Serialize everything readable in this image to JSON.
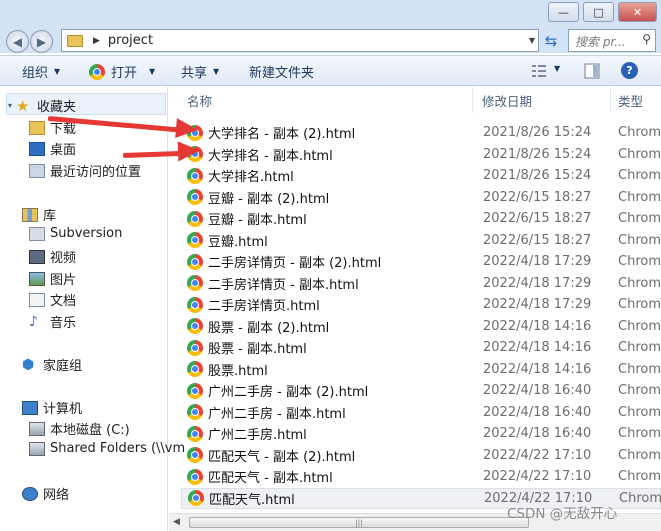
{
  "window": {
    "minimize": "—",
    "maximize": "□",
    "close": "✕"
  },
  "address": {
    "path": "project",
    "search_placeholder": "搜索 pr..."
  },
  "toolbar": {
    "organize": "组织",
    "open": "打开",
    "share": "共享",
    "new_folder": "新建文件夹",
    "help": "?"
  },
  "nav": {
    "favorites": "收藏夹",
    "downloads": "下载",
    "desktop": "桌面",
    "recent": "最近访问的位置",
    "libraries": "库",
    "subversion": "Subversion",
    "videos": "视频",
    "pictures": "图片",
    "documents": "文档",
    "music": "音乐",
    "homegroup": "家庭组",
    "computer": "计算机",
    "local_disk": "本地磁盘 (C:)",
    "shared_folders": "Shared Folders (\\\\vm",
    "network": "网络"
  },
  "columns": {
    "name": "名称",
    "modified": "修改日期",
    "type": "类型"
  },
  "files": [
    {
      "name": "大学排名 - 副本 (2).html",
      "date": "2021/8/26 15:24",
      "type": "Chrom"
    },
    {
      "name": "大学排名 - 副本.html",
      "date": "2021/8/26 15:24",
      "type": "Chrom"
    },
    {
      "name": "大学排名.html",
      "date": "2021/8/26 15:24",
      "type": "Chrom"
    },
    {
      "name": "豆瓣 - 副本 (2).html",
      "date": "2022/6/15 18:27",
      "type": "Chrom"
    },
    {
      "name": "豆瓣 - 副本.html",
      "date": "2022/6/15 18:27",
      "type": "Chrom"
    },
    {
      "name": "豆瓣.html",
      "date": "2022/6/15 18:27",
      "type": "Chrom"
    },
    {
      "name": "二手房详情页 - 副本 (2).html",
      "date": "2022/4/18 17:29",
      "type": "Chrom"
    },
    {
      "name": "二手房详情页 - 副本.html",
      "date": "2022/4/18 17:29",
      "type": "Chrom"
    },
    {
      "name": "二手房详情页.html",
      "date": "2022/4/18 17:29",
      "type": "Chrom"
    },
    {
      "name": "股票 - 副本 (2).html",
      "date": "2022/4/18 14:16",
      "type": "Chrom"
    },
    {
      "name": "股票 - 副本.html",
      "date": "2022/4/18 14:16",
      "type": "Chrom"
    },
    {
      "name": "股票.html",
      "date": "2022/4/18 14:16",
      "type": "Chrom"
    },
    {
      "name": "广州二手房 - 副本 (2).html",
      "date": "2022/4/18 16:40",
      "type": "Chrom"
    },
    {
      "name": "广州二手房 - 副本.html",
      "date": "2022/4/18 16:40",
      "type": "Chrom"
    },
    {
      "name": "广州二手房.html",
      "date": "2022/4/18 16:40",
      "type": "Chrom"
    },
    {
      "name": "匹配天气 - 副本 (2).html",
      "date": "2022/4/22 17:10",
      "type": "Chrom"
    },
    {
      "name": "匹配天气 - 副本.html",
      "date": "2022/4/22 17:10",
      "type": "Chrom"
    },
    {
      "name": "匹配天气.html",
      "date": "2022/4/22 17:10",
      "type": "Chrom"
    }
  ],
  "watermark": "CSDN @无敌开心"
}
